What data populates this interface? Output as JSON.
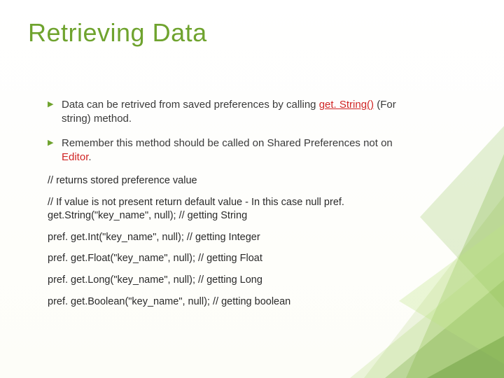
{
  "title": "Retrieving Data",
  "para1_a": "Data can be retrived from saved preferences by calling ",
  "para1_link": "get. String()",
  "para1_b": " (For string) method.",
  "para2_a": " Remember this method should be called on Shared Preferences not on ",
  "para2_red": "Editor",
  "para2_b": ".",
  "code": {
    "l1": "// returns stored preference value",
    "l2": "// If value is not present return default value - In this case null pref. get.String(\"key_name\", null); // getting String",
    "l3": "pref. get.Int(\"key_name\", null); // getting Integer",
    "l4": "pref. get.Float(\"key_name\", null); // getting Float",
    "l5": "pref. get.Long(\"key_name\", null); // getting Long",
    "l6": "pref. get.Boolean(\"key_name\", null); // getting boolean"
  }
}
